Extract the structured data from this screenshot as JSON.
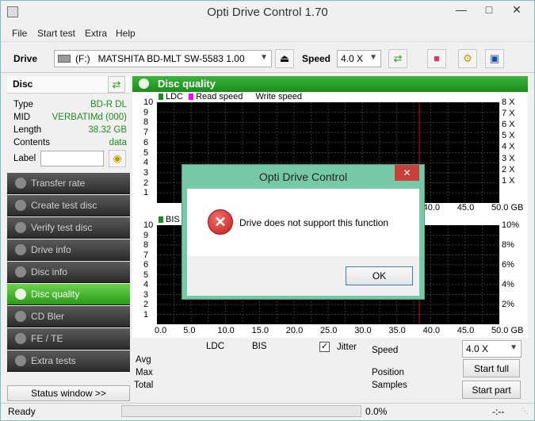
{
  "window": {
    "title": "Opti Drive Control 1.70"
  },
  "menu": [
    "File",
    "Start test",
    "Extra",
    "Help"
  ],
  "toolbar": {
    "drive_label": "Drive",
    "drive_letter": "(F:)",
    "drive_name": "MATSHITA BD-MLT SW-5583 1.00",
    "speed_label": "Speed",
    "speed_value": "4.0 X"
  },
  "disc": {
    "heading": "Disc",
    "rows": [
      {
        "k": "Type",
        "v": "BD-R DL"
      },
      {
        "k": "MID",
        "v": "VERBATIMd (000)"
      },
      {
        "k": "Length",
        "v": "38.32 GB"
      },
      {
        "k": "Contents",
        "v": "data"
      }
    ],
    "label_key": "Label",
    "label_value": ""
  },
  "nav": [
    "Transfer rate",
    "Create test disc",
    "Verify test disc",
    "Drive info",
    "Disc info",
    "Disc quality",
    "CD Bler",
    "FE / TE",
    "Extra tests"
  ],
  "nav_active": "Disc quality",
  "status_window_btn": "Status window >>",
  "status": {
    "text": "Ready",
    "progress": "0.0%",
    "time": "-:--"
  },
  "quality": {
    "title": "Disc quality",
    "legend_top": [
      "LDC",
      "Read speed",
      "Write speed"
    ],
    "legend_bottom": [
      "BIS"
    ],
    "y_left_top": [
      "10",
      "9",
      "8",
      "7",
      "6",
      "5",
      "4",
      "3",
      "2",
      "1"
    ],
    "y_right_top": [
      "8 X",
      "7 X",
      "6 X",
      "5 X",
      "4 X",
      "3 X",
      "2 X",
      "1 X"
    ],
    "x_top_visible": [
      "40.0",
      "45.0",
      "50.0 GB"
    ],
    "y_left_bottom": [
      "10",
      "9",
      "8",
      "7",
      "6",
      "5",
      "4",
      "3",
      "2",
      "1"
    ],
    "y_right_bottom": [
      "10%",
      "8%",
      "6%",
      "4%",
      "2%"
    ],
    "x_bottom": [
      "0.0",
      "5.0",
      "10.0",
      "15.0",
      "20.0",
      "25.0",
      "30.0",
      "35.0",
      "40.0",
      "45.0",
      "50.0 GB"
    ],
    "col_ldc": "LDC",
    "col_bis": "BIS",
    "jitter": "Jitter",
    "rows": [
      "Avg",
      "Max",
      "Total"
    ],
    "speed_label": "Speed",
    "speed_value": "4.0 X",
    "position_label": "Position",
    "samples_label": "Samples",
    "start_full": "Start full",
    "start_part": "Start part"
  },
  "colors": {
    "ldc": "#1e8c1e",
    "read_speed": "#ff00ff",
    "bis": "#1e8c1e",
    "marker": "#cc1111"
  },
  "dialog": {
    "title": "Opti Drive Control",
    "message": "Drive does not support this function",
    "ok": "OK",
    "close": "✕"
  }
}
